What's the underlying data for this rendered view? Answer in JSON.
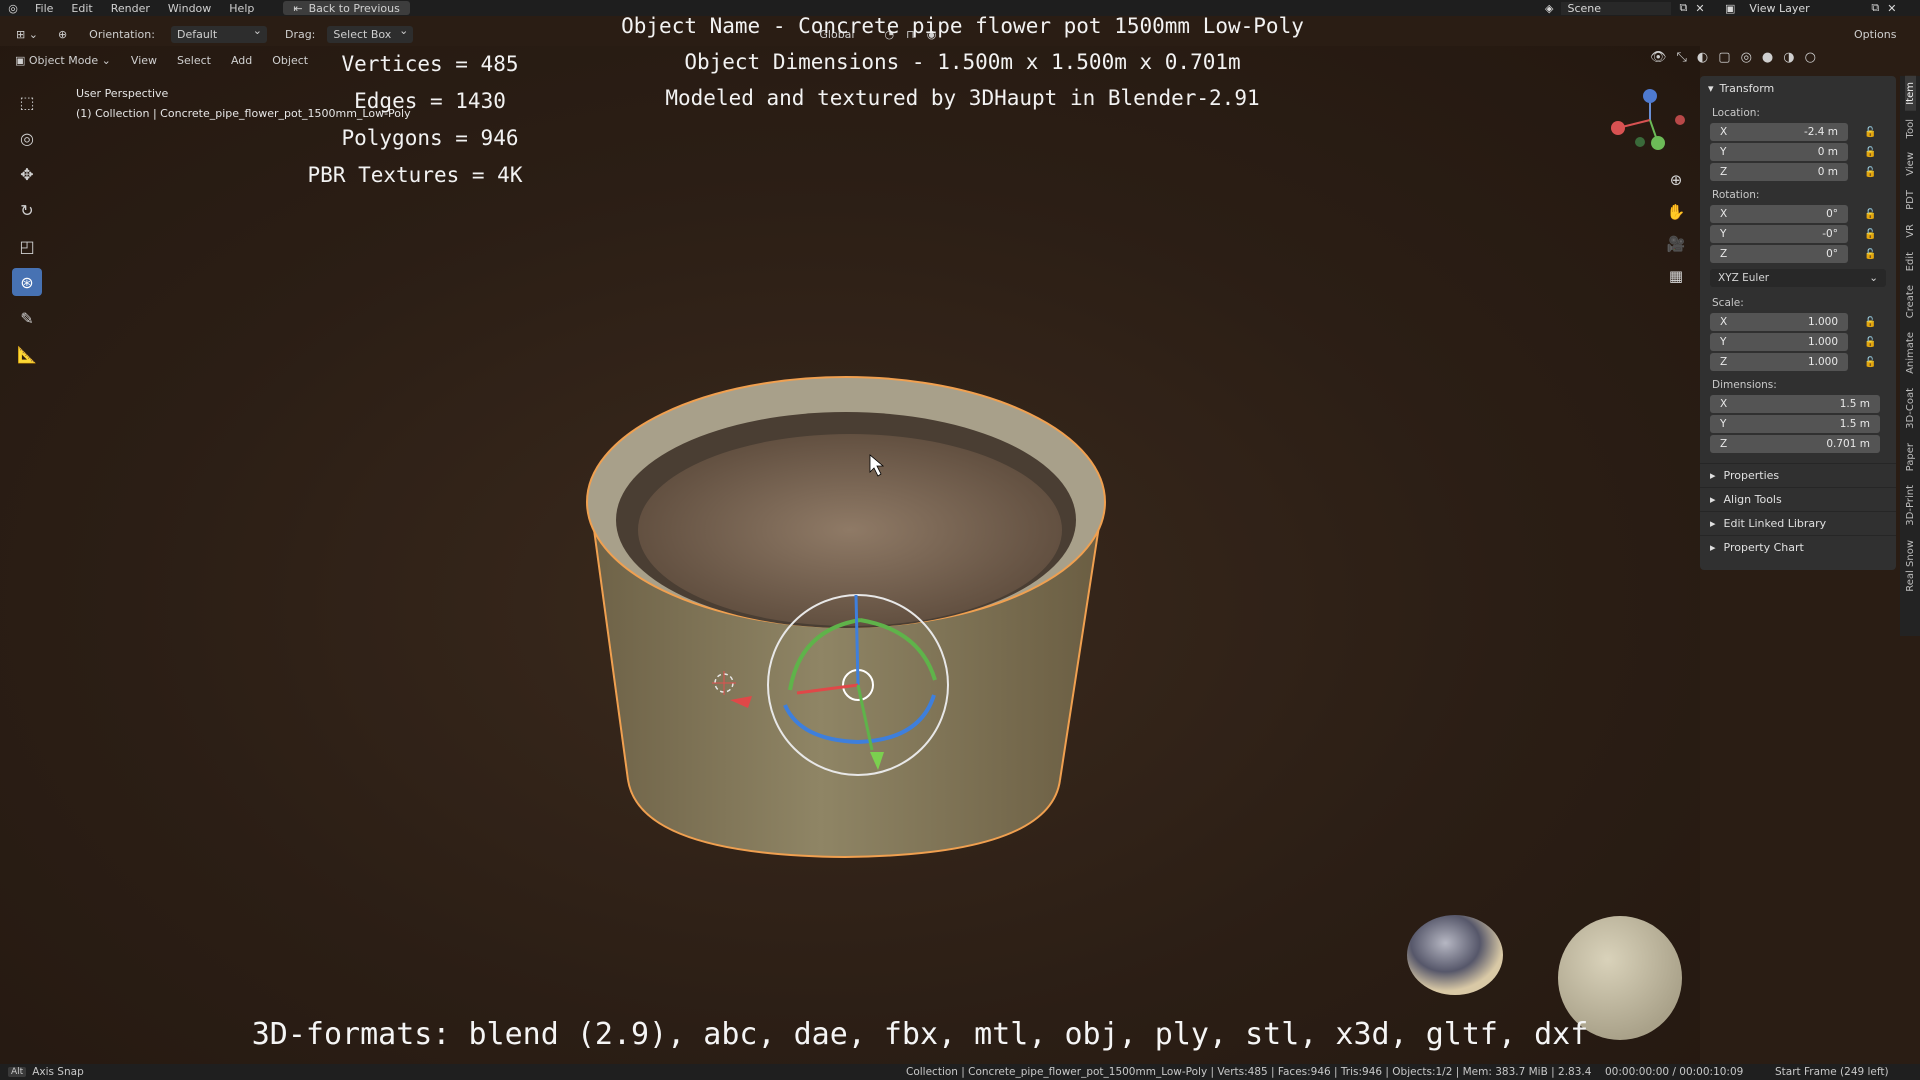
{
  "topbar": {
    "menu": [
      "File",
      "Edit",
      "Render",
      "Window",
      "Help"
    ],
    "back_button": "Back to Previous",
    "scene": "Scene",
    "view_layer": "View Layer"
  },
  "header": {
    "orientation_label": "Orientation:",
    "orientation_value": "Default",
    "drag_label": "Drag:",
    "drag_value": "Select Box",
    "transform_orientation": "Global",
    "options": "Options"
  },
  "mode_row": {
    "mode": "Object Mode",
    "view": "View",
    "select": "Select",
    "add": "Add",
    "object": "Object"
  },
  "viewport_info": {
    "perspective": "User Perspective",
    "collection": "(1) Collection | Concrete_pipe_flower_pot_1500mm_Low-Poly"
  },
  "overlay_stats": {
    "vertices": "Vertices = 485",
    "edges": "Edges = 1430",
    "polygons": "Polygons = 946",
    "textures": "PBR Textures = 4K"
  },
  "overlay_title": {
    "name": "Object Name - Concrete pipe flower pot 1500mm Low-Poly",
    "dimensions": "Object Dimensions -  1.500m x 1.500m x 0.701m",
    "credit": "Modeled and textured by 3DHaupt in Blender-2.91"
  },
  "formats": "3D-formats: blend (2.9), abc, dae, fbx, mtl, obj, ply, stl, x3d, gltf, dxf",
  "npanel": {
    "transform_title": "Transform",
    "location_label": "Location:",
    "location": [
      {
        "axis": "X",
        "value": "-2.4 m"
      },
      {
        "axis": "Y",
        "value": "0 m"
      },
      {
        "axis": "Z",
        "value": "0 m"
      }
    ],
    "rotation_label": "Rotation:",
    "rotation": [
      {
        "axis": "X",
        "value": "0°"
      },
      {
        "axis": "Y",
        "value": "-0°"
      },
      {
        "axis": "Z",
        "value": "0°"
      }
    ],
    "euler": "XYZ Euler",
    "scale_label": "Scale:",
    "scale": [
      {
        "axis": "X",
        "value": "1.000"
      },
      {
        "axis": "Y",
        "value": "1.000"
      },
      {
        "axis": "Z",
        "value": "1.000"
      }
    ],
    "dimensions_label": "Dimensions:",
    "dimensions": [
      {
        "axis": "X",
        "value": "1.5 m"
      },
      {
        "axis": "Y",
        "value": "1.5 m"
      },
      {
        "axis": "Z",
        "value": "0.701 m"
      }
    ],
    "panels": [
      "Properties",
      "Align Tools",
      "Edit Linked Library",
      "Property Chart"
    ]
  },
  "side_tabs": [
    "Item",
    "Tool",
    "View",
    "PDT",
    "VR",
    "Edit",
    "Create",
    "Animate",
    "3D-Coat",
    "Paper",
    "3D-Print",
    "Real Snow"
  ],
  "statusbar": {
    "key": "Alt",
    "axis_snap": "Axis Snap",
    "stats": "Collection | Concrete_pipe_flower_pot_1500mm_Low-Poly | Verts:485 | Faces:946 | Tris:946 | Objects:1/2 | Mem: 383.7 MiB | 2.83.4",
    "time": "00:00:00:00 / 00:00:10:09",
    "frame": "Start Frame (249 left)"
  },
  "colors": {
    "accent": "#4772b3",
    "selection_outline": "#f0a050",
    "background": "#2a1d14"
  },
  "icons": [
    "blender-logo-icon",
    "back-icon",
    "select-box-icon",
    "cursor-icon",
    "move-icon",
    "rotate-icon",
    "scale-icon",
    "transform-icon",
    "annotate-icon",
    "measure-icon",
    "zoom-icon",
    "hand-icon",
    "camera-icon",
    "grid-icon"
  ]
}
